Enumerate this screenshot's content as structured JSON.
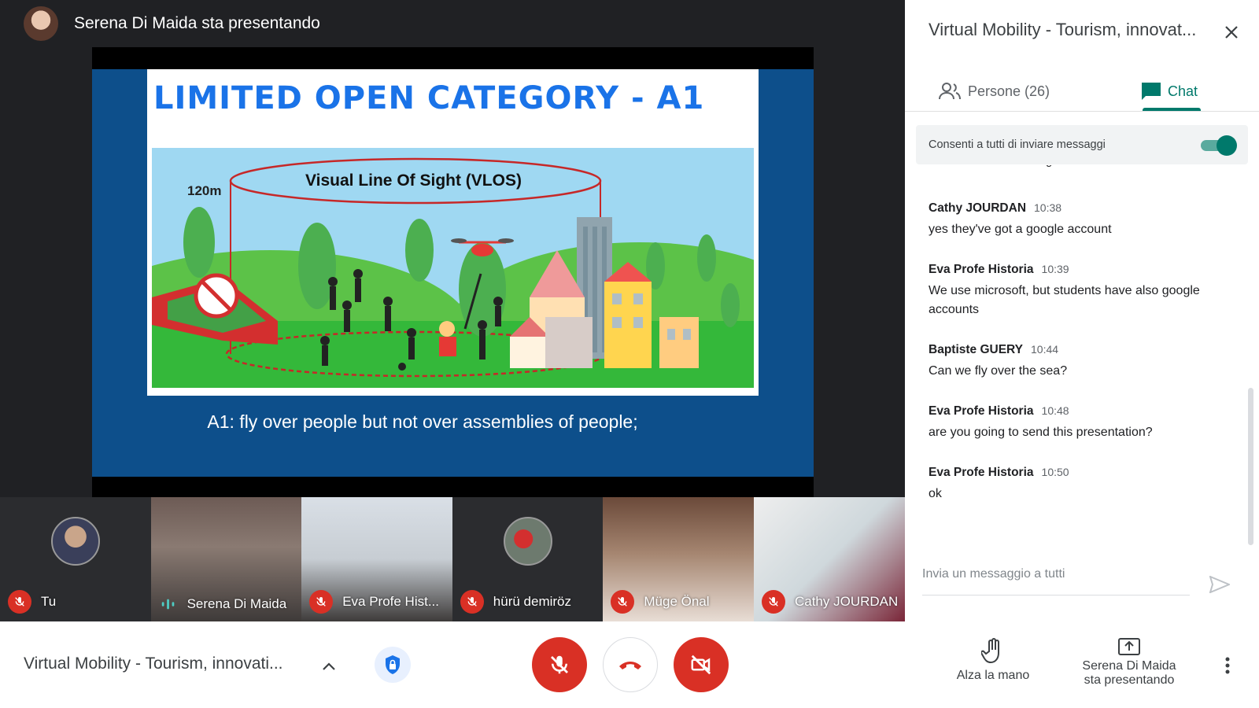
{
  "presenter": {
    "text": "Serena Di Maida sta presentando"
  },
  "slide": {
    "title": "LIMITED OPEN CATEGORY - A1",
    "height_label": "120m",
    "vlos_label": "Visual Line Of Sight (VLOS)",
    "caption": "A1: fly over people but not over assemblies of people;"
  },
  "participants": [
    {
      "name": "Tu",
      "status": "muted"
    },
    {
      "name": "Serena Di Maida",
      "status": "speaking"
    },
    {
      "name": "Eva Profe Hist...",
      "status": "muted"
    },
    {
      "name": "hürü demiröz",
      "status": "muted"
    },
    {
      "name": "Müge Önal",
      "status": "muted"
    },
    {
      "name": "Cathy JOURDAN",
      "status": "muted"
    }
  ],
  "panel": {
    "title": "Virtual Mobility - Tourism, innovat...",
    "tabs": {
      "people": "Persone (26)",
      "chat": "Chat"
    },
    "allow_label": "Consenti a tutti di inviare messaggi",
    "allow_enabled": true,
    "partial_message": "We can see. Interesting",
    "messages": [
      {
        "sender": "Cathy JOURDAN",
        "time": "10:38",
        "text": "yes they've got a google account"
      },
      {
        "sender": "Eva Profe Historia",
        "time": "10:39",
        "text": "We use microsoft, but students have also google accounts"
      },
      {
        "sender": "Baptiste GUERY",
        "time": "10:44",
        "text": "Can we fly over the sea?"
      },
      {
        "sender": "Eva Profe Historia",
        "time": "10:48",
        "text": "are you going to send this presentation?"
      },
      {
        "sender": "Eva Profe Historia",
        "time": "10:50",
        "text": "ok"
      }
    ],
    "input_placeholder": "Invia un messaggio a tutti"
  },
  "bottom": {
    "meeting_title": "Virtual Mobility - Tourism, innovati...",
    "raise_hand": "Alza la mano",
    "presenting_line1": "Serena Di Maida",
    "presenting_line2": "sta presentando"
  },
  "colors": {
    "accent": "#00796b",
    "danger": "#d93025",
    "title_blue": "#1a73e8",
    "slide_bg": "#0d4f8b"
  }
}
